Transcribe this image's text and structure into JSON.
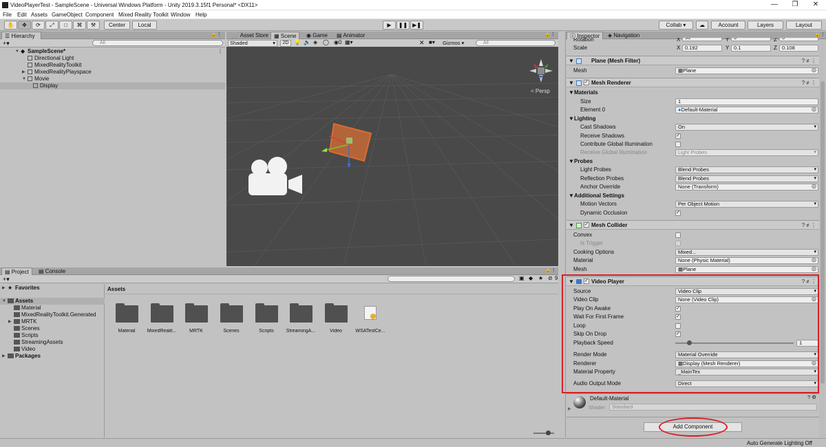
{
  "window": {
    "title": "VideoPlayerTest - SampleScene - Universal Windows Platform - Unity 2019.3.15f1 Personal* <DX11>",
    "minimize": "—",
    "maximize": "❐",
    "close": "✕"
  },
  "menu": [
    "File",
    "Edit",
    "Assets",
    "GameObject",
    "Component",
    "Mixed Reality Toolkit",
    "Window",
    "Help"
  ],
  "toolbar": {
    "tools": [
      "✋",
      "✥",
      "⟳",
      "⤢",
      "□",
      "⌘",
      "⚒"
    ],
    "pivot": "Center",
    "space": "Local",
    "play": "▶",
    "pause": "❚❚",
    "step": "▶❚",
    "collab": "Collab ▾",
    "cloud": "☁",
    "account": "Account",
    "layers": "Layers",
    "layout": "Layout"
  },
  "hierarchy": {
    "tab": "Hierarchy",
    "add": "+▾",
    "search_placeholder": "All",
    "scene": "SampleScene*",
    "items": [
      "Directional Light",
      "MixedRealityToolkit",
      "MixedRealityPlayspace",
      "Movie",
      "Display"
    ]
  },
  "scene_tabs": [
    "Asset Store",
    "Scene",
    "Game",
    "Animator"
  ],
  "scene_bar": {
    "shading": "Shaded",
    "mode2d": "2D",
    "fx": "0",
    "gizmos": "Gizmos",
    "search_placeholder": "All",
    "persp": "< Persp"
  },
  "project": {
    "tabs": [
      "Project",
      "Console"
    ],
    "add": "+▾",
    "favorites": "Favorites",
    "assets_root": "Assets",
    "tree": [
      "Material",
      "MixedRealityToolkit.Generated",
      "MRTK",
      "Scenes",
      "Scripts",
      "StreamingAssets",
      "Video"
    ],
    "packages": "Packages",
    "breadcrumb": "Assets",
    "hidden_count": "9",
    "grid": [
      "Material",
      "MixedRealit...",
      "MRTK",
      "Scenes",
      "Scripts",
      "StreamingA...",
      "Video",
      "WSATestCe..."
    ]
  },
  "inspector": {
    "tabs": [
      "Inspector",
      "Navigation"
    ],
    "transform": {
      "rotation_label": "Rotation",
      "rotation": {
        "x": "90",
        "y": "0",
        "z": "0"
      },
      "scale_label": "Scale",
      "scale": {
        "x": "0.192",
        "y": "0.1",
        "z": "0.108"
      }
    },
    "mesh_filter": {
      "title": "Plane (Mesh Filter)",
      "mesh_label": "Mesh",
      "mesh": "Plane"
    },
    "mesh_renderer": {
      "title": "Mesh Renderer",
      "materials": "Materials",
      "size_label": "Size",
      "size": "1",
      "element_label": "Element 0",
      "element": "Default-Material",
      "lighting": "Lighting",
      "cast_shadows_label": "Cast Shadows",
      "cast_shadows": "On",
      "receive_shadows_label": "Receive Shadows",
      "contribute_gi_label": "Contribute Global Illumination",
      "receive_gi_label": "Receive Global Illumination",
      "receive_gi": "Light Probes",
      "probes": "Probes",
      "light_probes_label": "Light Probes",
      "light_probes": "Blend Probes",
      "reflection_probes_label": "Reflection Probes",
      "reflection_probes": "Blend Probes",
      "anchor_override_label": "Anchor Override",
      "anchor_override": "None (Transform)",
      "additional": "Additional Settings",
      "motion_vectors_label": "Motion Vectors",
      "motion_vectors": "Per Object Motion",
      "dynamic_occlusion_label": "Dynamic Occlusion"
    },
    "mesh_collider": {
      "title": "Mesh Collider",
      "convex_label": "Convex",
      "is_trigger_label": "Is Trigger",
      "cooking_label": "Cooking Options",
      "cooking": "Mixed...",
      "material_label": "Material",
      "material": "None (Physic Material)",
      "mesh_label": "Mesh",
      "mesh": "Plane"
    },
    "video_player": {
      "title": "Video Player",
      "source_label": "Source",
      "source": "Video Clip",
      "video_clip_label": "Video Clip",
      "video_clip": "None (Video Clip)",
      "play_on_awake_label": "Play On Awake",
      "wait_first_frame_label": "Wait For First Frame",
      "loop_label": "Loop",
      "skip_on_drop_label": "Skip On Drop",
      "playback_speed_label": "Playback Speed",
      "playback_speed": "1",
      "render_mode_label": "Render Mode",
      "render_mode": "Material Override",
      "renderer_label": "Renderer",
      "renderer": "Display (Mesh Renderer)",
      "material_property_label": "Material Property",
      "material_property": "_MainTex",
      "audio_output_label": "Audio Output Mode",
      "audio_output": "Direct"
    },
    "material": {
      "name": "Default-Material",
      "shader_label": "Shader",
      "shader": "Standard"
    },
    "add_component": "Add Component"
  },
  "status": "Auto Generate Lighting Off",
  "colors": {
    "highlight": "#d81f26",
    "selection": "#b0b0b0",
    "scene_bg": "#494949",
    "plane": "#e8722a"
  }
}
